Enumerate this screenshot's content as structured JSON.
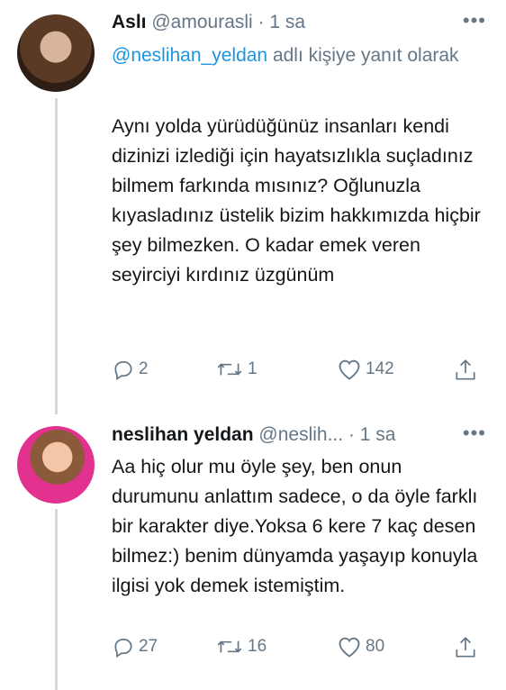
{
  "tweets": [
    {
      "name": "Aslı",
      "handle": "@amourasli",
      "time": "· 1 sa",
      "more": "•••",
      "reply_mention": "@neslihan_yeldan",
      "reply_suffix": " adlı kişiye yanıt olarak",
      "text": "Aynı yolda yürüdüğünüz insanları kendi dizinizi izlediği için hayatsızlıkla suçladınız bilmem farkında mısınız? Oğlunuzla kıyasladınız üstelik bizim hakkımızda hiçbir şey bilmezken. O kadar emek veren seyirciyi kırdınız üzgünüm",
      "replies": "2",
      "retweets": "1",
      "likes": "142"
    },
    {
      "name": "neslihan yeldan",
      "handle": "@neslih...",
      "time": "· 1 sa",
      "more": "•••",
      "text": "Aa hiç olur mu öyle şey, ben onun durumunu anlattım sadece, o da öyle farklı bir karakter diye.Yoksa 6 kere 7 kaç desen bilmez:) benim dünyamda yaşayıp konuyla ilgisi yok demek istemiştim.",
      "replies": "27",
      "retweets": "16",
      "likes": "80"
    }
  ],
  "icons": {
    "reply": "reply-icon",
    "retweet": "retweet-icon",
    "like": "heart-icon",
    "share": "share-icon"
  },
  "colors": {
    "text": "#14171a",
    "secondary": "#657786",
    "link": "#1b95e0",
    "thread_line": "#cfd9de"
  }
}
